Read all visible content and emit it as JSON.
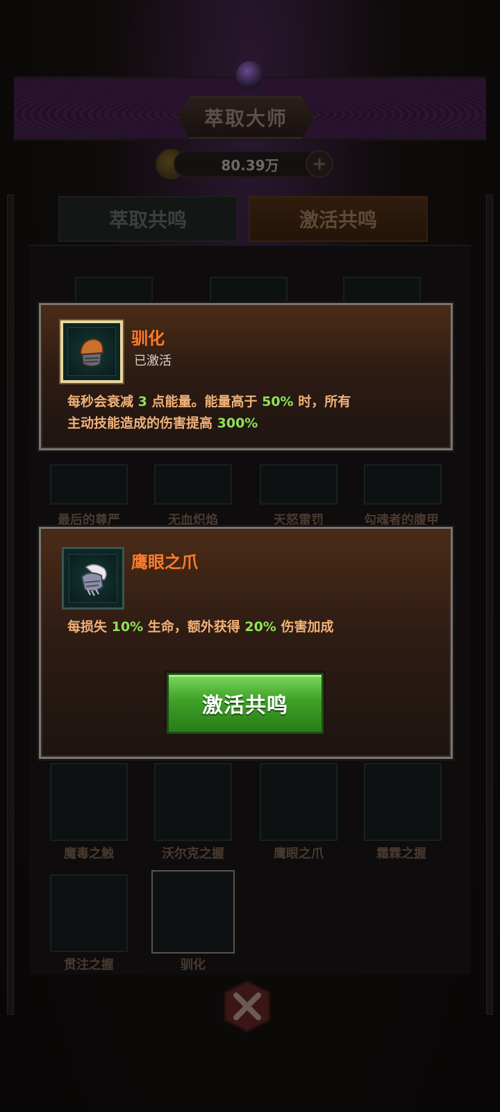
{
  "header": {
    "title": "萃取大师",
    "currency_amount": "80.39万",
    "coin_icon": "gold-coin-icon",
    "add_icon": "plus-icon"
  },
  "tabs": [
    {
      "label": "萃取共鸣",
      "active": false
    },
    {
      "label": "激活共鸣",
      "active": true
    }
  ],
  "background_items": {
    "row_labels": [
      "最后的尊严",
      "无血炽焰",
      "天怒雷罚",
      "勾魂者的腹甲"
    ],
    "grid_row_1": [
      "魔毒之触",
      "沃尔克之握",
      "鹰眼之爪",
      "霜霖之握"
    ],
    "grid_row_2": [
      "贯注之握",
      "驯化"
    ]
  },
  "current_item": {
    "name": "驯化",
    "status": "已激活",
    "icon": "gauntlet-icon",
    "desc_parts": [
      "每秒会衰减 ",
      "3",
      " 点能量。能量高于 ",
      "50%",
      " 时，所有",
      "主动技能造成的伤害提高 ",
      "300%"
    ]
  },
  "target_item": {
    "name": "鹰眼之爪",
    "icon": "claw-gauntlet-icon",
    "desc_parts": [
      "每损失 ",
      "10%",
      " 生命，额外获得 ",
      "20%",
      " 伤害加成"
    ],
    "button_label": "激活共鸣"
  },
  "colors": {
    "accent_orange": "#ff7b2a",
    "value_green": "#8fe35a",
    "button_green": "#3ea028"
  }
}
